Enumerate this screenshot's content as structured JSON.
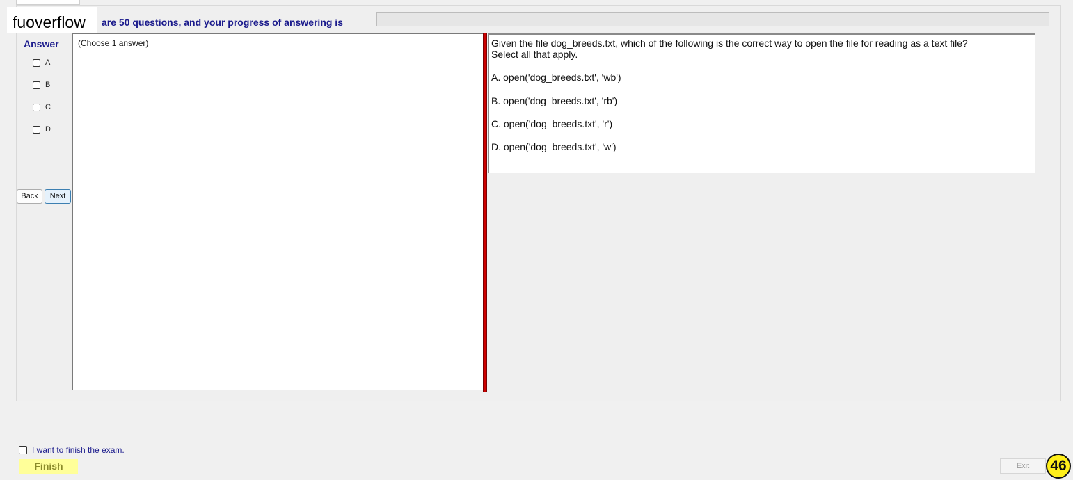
{
  "watermark": "fuoverflow",
  "header": {
    "progress_text": "are 50 questions, and your progress of answering is",
    "progress_fraction": 0
  },
  "answer_panel": {
    "heading": "Answer",
    "options": [
      "A",
      "B",
      "C",
      "D"
    ],
    "back_label": "Back",
    "next_label": "Next",
    "choose_text": "(Choose 1 answer)"
  },
  "question": {
    "line1": "Given the file dog_breeds.txt, which of the following is the correct way to open the file for reading as a text file?",
    "line2": "Select all that apply.",
    "choices": [
      "A.  open('dog_breeds.txt', 'wb')",
      "B.  open('dog_breeds.txt', 'rb')",
      "C.  open('dog_breeds.txt', 'r')",
      "D.  open('dog_breeds.txt', 'w')"
    ]
  },
  "footer": {
    "finish_checkbox_label": "I want to finish the exam.",
    "finish_label": "Finish",
    "exit_label": "Exit",
    "page_number": "46"
  },
  "colors": {
    "accent_text": "#1a1a8c",
    "splitter": "#cc0000",
    "finish_bg": "#ffff99",
    "badge_bg": "#ffef1a"
  }
}
